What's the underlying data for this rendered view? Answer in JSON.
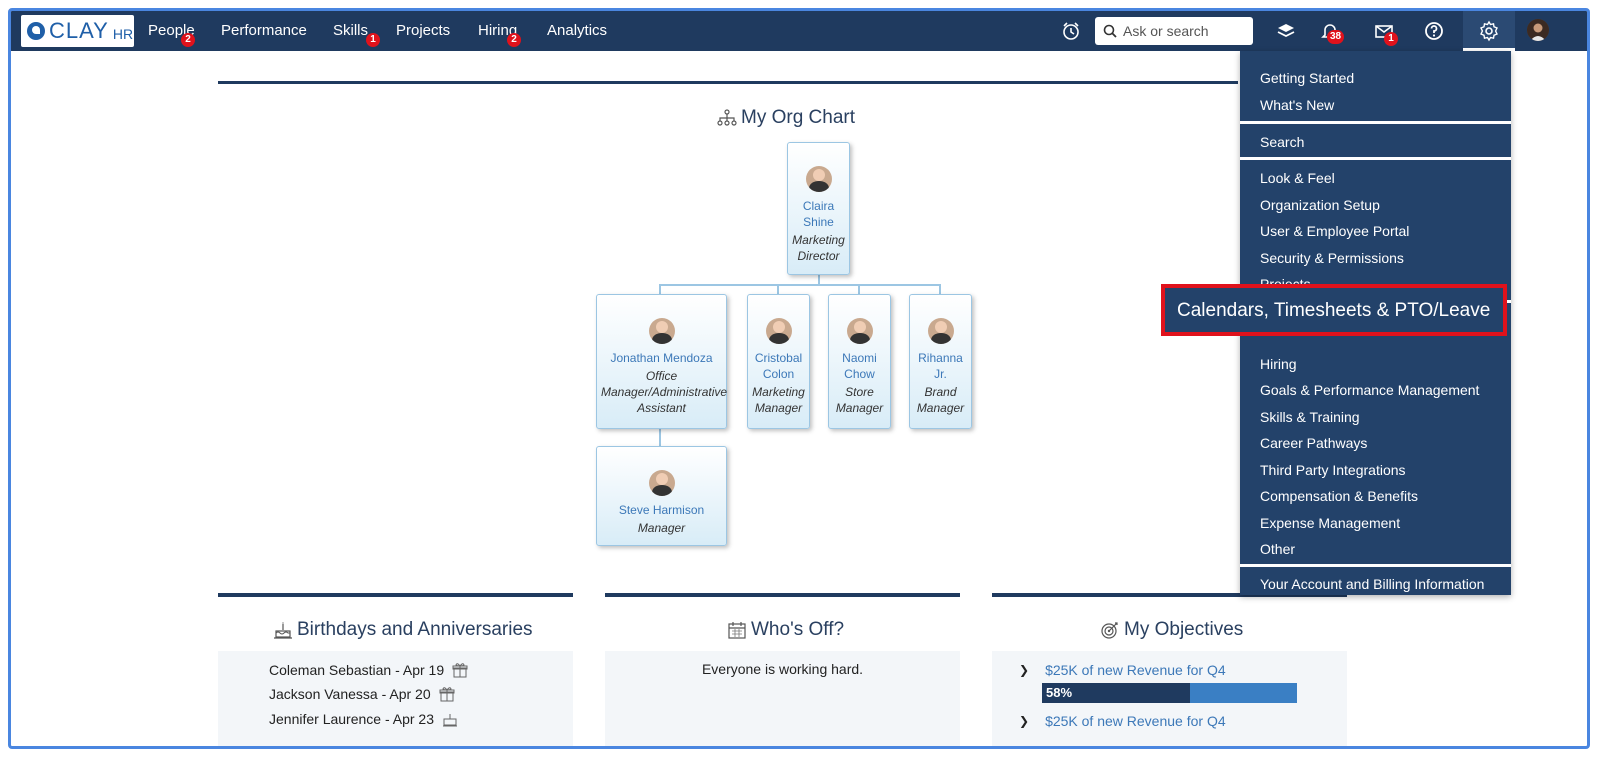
{
  "app": {
    "logo_text": "CLAY",
    "logo_sub": "HR"
  },
  "nav": {
    "items": [
      {
        "label": "People",
        "badge": "2"
      },
      {
        "label": "Performance",
        "badge": ""
      },
      {
        "label": "Skills",
        "badge": "1"
      },
      {
        "label": "Projects",
        "badge": ""
      },
      {
        "label": "Hiring",
        "badge": "2"
      },
      {
        "label": "Analytics",
        "badge": ""
      }
    ],
    "search_placeholder": "Ask or search",
    "notifications_badge": "38",
    "mail_badge": "1"
  },
  "org_chart": {
    "title": "My Org Chart",
    "root": {
      "name_lines": [
        "Claira",
        "Shine"
      ],
      "title_lines": [
        "Marketing",
        "Director"
      ]
    },
    "reports": [
      {
        "name_lines": [
          "Jonathan Mendoza"
        ],
        "title_lines": [
          "Office",
          "Manager/Administrative",
          "Assistant"
        ]
      },
      {
        "name_lines": [
          "Cristobal",
          "Colon"
        ],
        "title_lines": [
          "Marketing",
          "Manager"
        ]
      },
      {
        "name_lines": [
          "Naomi",
          "Chow"
        ],
        "title_lines": [
          "Store",
          "Manager"
        ]
      },
      {
        "name_lines": [
          "Rihanna",
          "Jr."
        ],
        "title_lines": [
          "Brand",
          "Manager"
        ]
      }
    ],
    "sub_report": {
      "name_lines": [
        "Steve Harmison"
      ],
      "title_lines": [
        "Manager"
      ]
    }
  },
  "birthdays": {
    "title": "Birthdays and Anniversaries",
    "items": [
      {
        "text": "Coleman Sebastian - Apr 19",
        "icon": "gift-icon"
      },
      {
        "text": "Jackson Vanessa - Apr 20",
        "icon": "gift-icon"
      },
      {
        "text": "Jennifer Laurence - Apr 23",
        "icon": "cake-icon"
      }
    ]
  },
  "whos_off": {
    "title": "Who's Off?",
    "message": "Everyone is working hard."
  },
  "objectives": {
    "title": "My Objectives",
    "items": [
      {
        "label": "$25K of new Revenue for Q4",
        "progress_label": "58%",
        "progress": 58
      },
      {
        "label": "$25K of new Revenue for Q4"
      }
    ]
  },
  "settings_menu": {
    "groups": [
      [
        "Getting Started",
        "What's New"
      ],
      [
        "Search"
      ],
      [
        "Look & Feel",
        "Organization Setup",
        "User & Employee Portal",
        "Security & Permissions",
        "Projects"
      ],
      [
        "Calendars, Timesheets & PTO/Leave",
        "Hiring",
        "Goals & Performance Management",
        "Skills & Training",
        "Career Pathways",
        "Third Party Integrations",
        "Compensation & Benefits",
        "Expense Management",
        "Other"
      ],
      [
        "Your Account and Billing Information"
      ]
    ],
    "highlighted": "Calendars, Timesheets & PTO/Leave"
  },
  "colors": {
    "nav_bg": "#1f3a5f",
    "accent": "#3c78b8",
    "badge": "#e0121c",
    "highlight_border": "#e0121c"
  }
}
